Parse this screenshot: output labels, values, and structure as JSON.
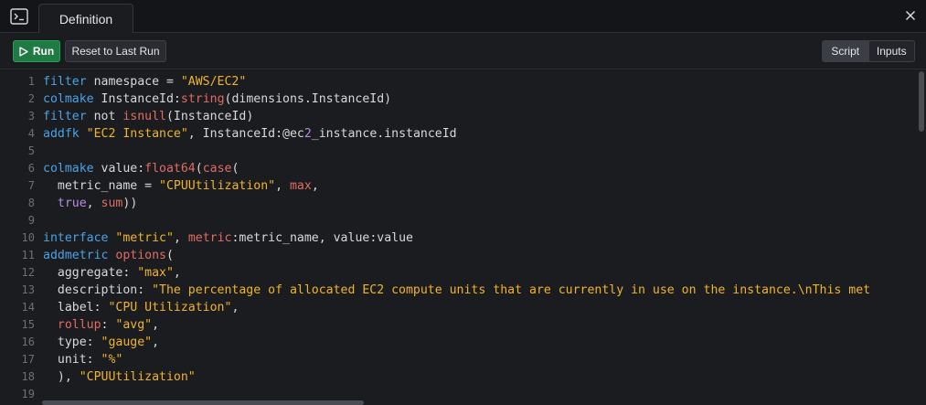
{
  "tabs": {
    "active_label": "Definition"
  },
  "icons": {
    "terminal": "terminal-icon",
    "close": "close-icon",
    "play": "play-icon"
  },
  "toolbar": {
    "run_label": "Run",
    "reset_label": "Reset to Last Run",
    "view_modes": [
      "Script",
      "Inputs"
    ],
    "active_view": "Script"
  },
  "colors": {
    "keyword": "#4aa3e6",
    "function": "#e06c63",
    "string": "#f0b429",
    "atom": "#b58be0",
    "run_button": "#1f7a43"
  },
  "editor": {
    "lines": [
      {
        "n": "1",
        "tokens": [
          [
            "kw",
            "filter"
          ],
          [
            "",
            "namespace = "
          ],
          [
            "str",
            "\"AWS/EC2\""
          ]
        ]
      },
      {
        "n": "2",
        "tokens": [
          [
            "kw",
            "colmake"
          ],
          [
            "",
            "InstanceId:"
          ],
          [
            "fn",
            "string"
          ],
          [
            "",
            "(dimensions.InstanceId)"
          ]
        ]
      },
      {
        "n": "3",
        "tokens": [
          [
            "kw",
            "filter"
          ],
          [
            "",
            "not "
          ],
          [
            "fn",
            "isnull"
          ],
          [
            "",
            "(InstanceId)"
          ]
        ]
      },
      {
        "n": "4",
        "tokens": [
          [
            "kw",
            "addfk"
          ],
          [
            "str",
            "\"EC2 Instance\""
          ],
          [
            "",
            ", InstanceId:@ec"
          ],
          [
            "atom",
            "2"
          ],
          [
            "",
            "_instance.instanceId"
          ]
        ]
      },
      {
        "n": "5",
        "tokens": []
      },
      {
        "n": "6",
        "tokens": [
          [
            "kw",
            "colmake"
          ],
          [
            "",
            "value:"
          ],
          [
            "fn",
            "float64"
          ],
          [
            "",
            "("
          ],
          [
            "fn",
            "case"
          ],
          [
            "",
            "("
          ]
        ]
      },
      {
        "n": "7",
        "tokens": [
          [
            "",
            "  metric_name = "
          ],
          [
            "str",
            "\"CPUUtilization\""
          ],
          [
            "",
            ", "
          ],
          [
            "fn",
            "max"
          ],
          [
            "",
            ","
          ]
        ]
      },
      {
        "n": "8",
        "tokens": [
          [
            "",
            "  "
          ],
          [
            "atom",
            "true"
          ],
          [
            "",
            ", "
          ],
          [
            "fn",
            "sum"
          ],
          [
            "",
            "))"
          ]
        ]
      },
      {
        "n": "9",
        "tokens": []
      },
      {
        "n": "10",
        "tokens": [
          [
            "kw",
            "interface"
          ],
          [
            "str",
            "\"metric\""
          ],
          [
            "",
            ", "
          ],
          [
            "fn",
            "metric"
          ],
          [
            "",
            ":metric_name, value:value"
          ]
        ]
      },
      {
        "n": "11",
        "tokens": [
          [
            "kw",
            "addmetric"
          ],
          [
            "fn",
            "options"
          ],
          [
            "",
            "("
          ]
        ]
      },
      {
        "n": "12",
        "tokens": [
          [
            "",
            "  aggregate: "
          ],
          [
            "str",
            "\"max\""
          ],
          [
            "",
            ","
          ]
        ]
      },
      {
        "n": "13",
        "tokens": [
          [
            "",
            "  description: "
          ],
          [
            "str",
            "\"The percentage of allocated EC2 compute units that are currently in use on the instance.\\nThis met"
          ]
        ]
      },
      {
        "n": "14",
        "tokens": [
          [
            "",
            "  label: "
          ],
          [
            "str",
            "\"CPU Utilization\""
          ],
          [
            "",
            ","
          ]
        ]
      },
      {
        "n": "15",
        "tokens": [
          [
            "",
            "  "
          ],
          [
            "fn",
            "rollup"
          ],
          [
            "",
            ": "
          ],
          [
            "str",
            "\"avg\""
          ],
          [
            "",
            ","
          ]
        ]
      },
      {
        "n": "16",
        "tokens": [
          [
            "",
            "  type: "
          ],
          [
            "str",
            "\"gauge\""
          ],
          [
            "",
            ","
          ]
        ]
      },
      {
        "n": "17",
        "tokens": [
          [
            "",
            "  unit: "
          ],
          [
            "str",
            "\"%\""
          ]
        ]
      },
      {
        "n": "18",
        "tokens": [
          [
            "",
            "  ), "
          ],
          [
            "str",
            "\"CPUUtilization\""
          ]
        ]
      },
      {
        "n": "19",
        "tokens": []
      }
    ]
  }
}
